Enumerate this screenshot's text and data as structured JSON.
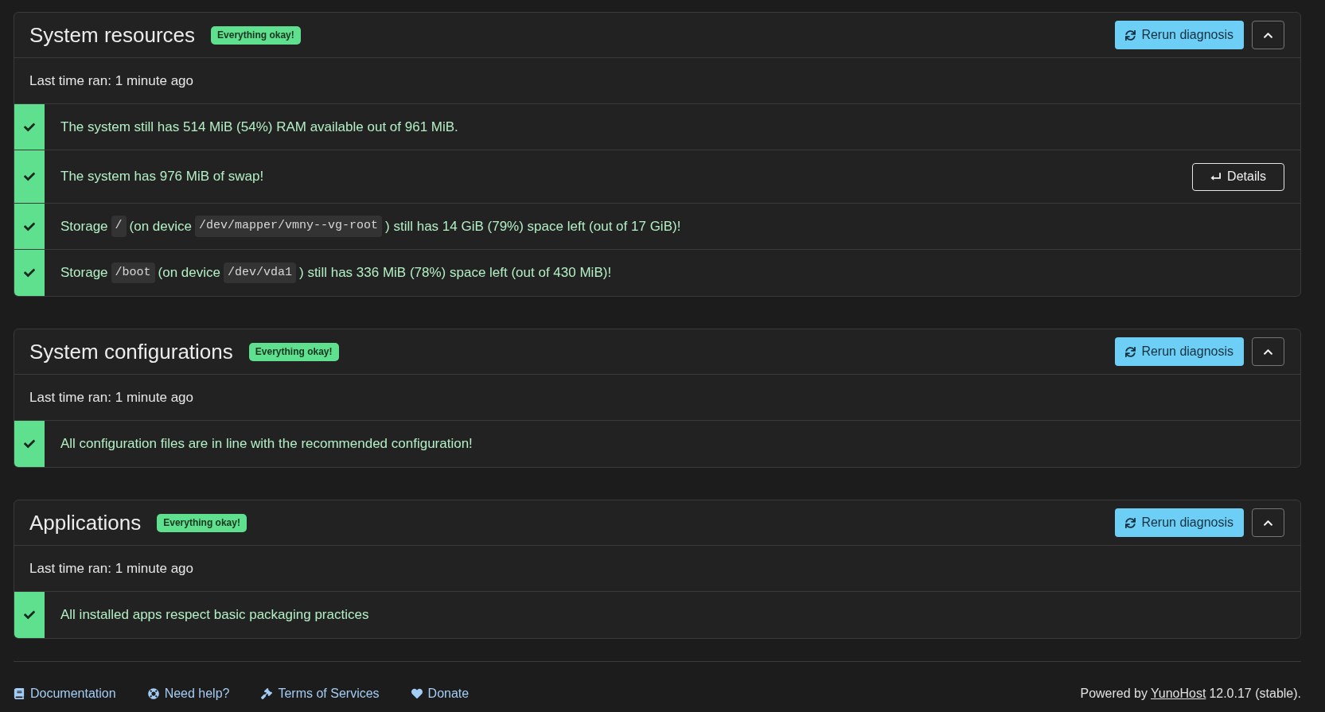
{
  "sections": [
    {
      "title": "System resources",
      "badge": {
        "label": "Everything okay!",
        "kind": "success"
      },
      "rerun_button": "Rerun diagnosis",
      "expanded": true,
      "last_run": "Last time ran: 1 minute ago",
      "items": [
        {
          "kind": "success",
          "parts": [
            {
              "kind": "text",
              "text": "The system still has 514 MiB (54%) RAM available out of 961 MiB."
            }
          ]
        },
        {
          "kind": "success",
          "parts": [
            {
              "kind": "text",
              "text": "The system has 976 MiB of swap!"
            }
          ],
          "details_button": "Details"
        },
        {
          "kind": "success",
          "parts": [
            {
              "kind": "text",
              "text": "Storage"
            },
            {
              "kind": "code",
              "text": "/"
            },
            {
              "kind": "text",
              "text": "(on device"
            },
            {
              "kind": "code",
              "text": "/dev/mapper/vmny--vg-root"
            },
            {
              "kind": "text",
              "text": ") still has 14 GiB (79%) space left (out of 17 GiB)!"
            }
          ]
        },
        {
          "kind": "success",
          "parts": [
            {
              "kind": "text",
              "text": "Storage"
            },
            {
              "kind": "code",
              "text": "/boot"
            },
            {
              "kind": "text",
              "text": "(on device"
            },
            {
              "kind": "code",
              "text": "/dev/vda1"
            },
            {
              "kind": "text",
              "text": ") still has 336 MiB (78%) space left (out of 430 MiB)!"
            }
          ]
        }
      ]
    },
    {
      "title": "System configurations",
      "badge": {
        "label": "Everything okay!",
        "kind": "success"
      },
      "rerun_button": "Rerun diagnosis",
      "expanded": true,
      "last_run": "Last time ran: 1 minute ago",
      "items": [
        {
          "kind": "success",
          "parts": [
            {
              "kind": "text",
              "text": "All configuration files are in line with the recommended configuration!"
            }
          ]
        }
      ]
    },
    {
      "title": "Applications",
      "badge": {
        "label": "Everything okay!",
        "kind": "success"
      },
      "rerun_button": "Rerun diagnosis",
      "expanded": true,
      "last_run": "Last time ran: 1 minute ago",
      "items": [
        {
          "kind": "success",
          "parts": [
            {
              "kind": "text",
              "text": "All installed apps respect basic packaging practices"
            }
          ]
        }
      ]
    }
  ],
  "footer": {
    "links": [
      {
        "kind": "documentation",
        "label": "Documentation"
      },
      {
        "kind": "help",
        "label": "Need help?"
      },
      {
        "kind": "terms",
        "label": "Terms of Services"
      },
      {
        "kind": "donate",
        "label": "Donate"
      }
    ],
    "powered_by": {
      "before": "Powered by",
      "link": "YunoHost",
      "after": "12.0.17 (stable)."
    }
  }
}
